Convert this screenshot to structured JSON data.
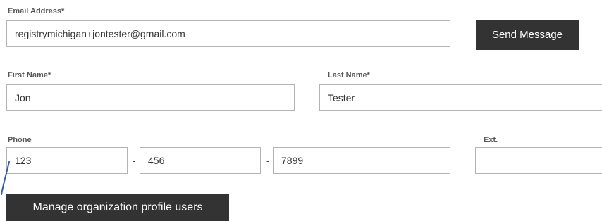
{
  "email": {
    "label": "Email Address*",
    "value": "registrymichigan+jontester@gmail.com"
  },
  "send_button": {
    "label": "Send Message"
  },
  "first_name": {
    "label": "First Name*",
    "value": "Jon"
  },
  "last_name": {
    "label": "Last Name*",
    "value": "Tester"
  },
  "phone": {
    "label": "Phone",
    "part1": "123",
    "part2": "456",
    "part3": "7899",
    "separator": "-"
  },
  "ext": {
    "label": "Ext.",
    "value": ""
  },
  "manage_button": {
    "label": "Manage organization profile users"
  },
  "colors": {
    "button_bg": "#333333",
    "button_text": "#ffffff",
    "field_border": "#b3b3b3",
    "pointer_stroke": "#2f5d9e"
  },
  "icons": {
    "pointer": "pen-stroke-icon"
  }
}
